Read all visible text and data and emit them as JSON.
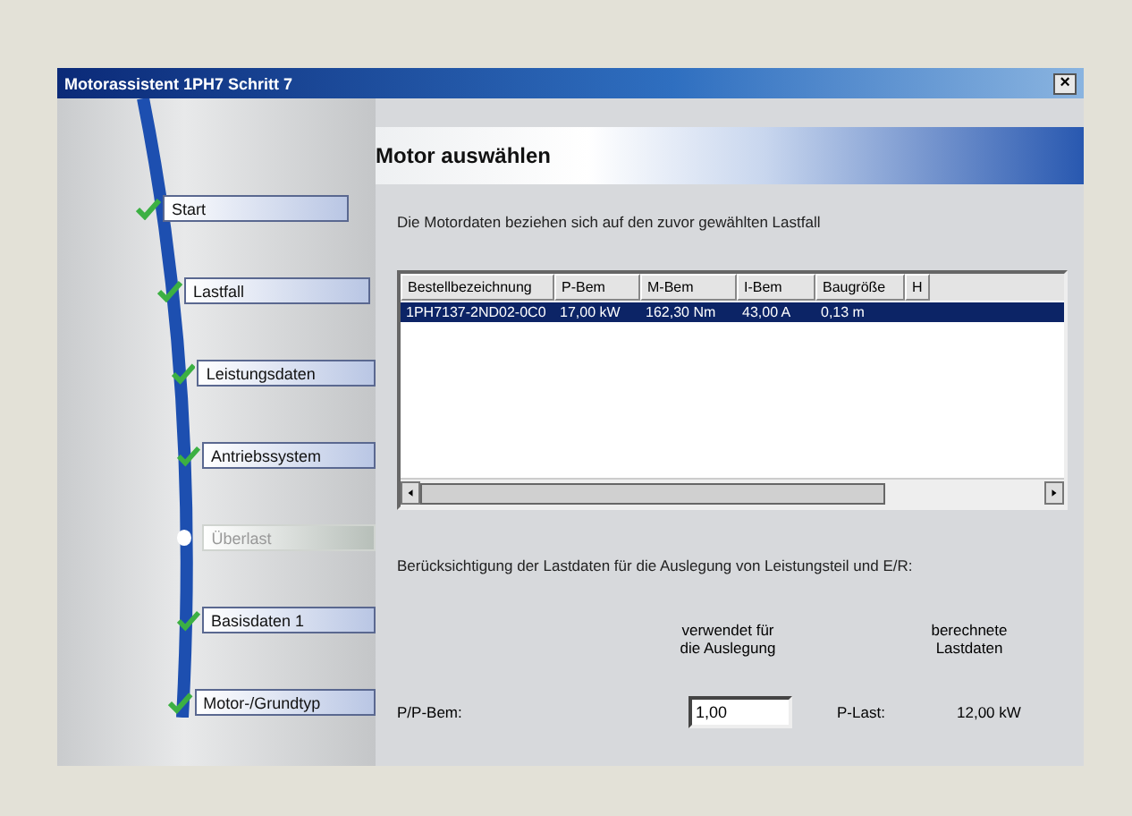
{
  "window": {
    "title": "Motorassistent 1PH7 Schritt 7",
    "close": "×"
  },
  "steps": [
    {
      "label": "Start",
      "done": true
    },
    {
      "label": "Lastfall",
      "done": true
    },
    {
      "label": "Leistungsdaten",
      "done": true
    },
    {
      "label": "Antriebssystem",
      "done": true
    },
    {
      "label": "Überlast",
      "done": false
    },
    {
      "label": "Basisdaten 1",
      "done": true
    },
    {
      "label": "Motor-/Grundtyp",
      "done": true
    }
  ],
  "header": "Motor auswählen",
  "intro": "Die Motordaten beziehen sich auf den zuvor gewählten Lastfall",
  "table": {
    "columns": [
      "Bestellbezeichnung",
      "P-Bem",
      "M-Bem",
      "I-Bem",
      "Baugröße",
      "H"
    ],
    "rows": [
      {
        "cells": [
          "1PH7137-2ND02-0C0",
          "17,00 kW",
          "162,30 Nm",
          "43,00 A",
          "0,13 m"
        ],
        "selected": true
      }
    ]
  },
  "load_note": "Berücksichtigung der Lastdaten für die Auslegung von Leistungsteil und E/R:",
  "col_used": [
    "verwendet für",
    "die Auslegung"
  ],
  "col_calc": [
    "berechnete",
    "Lastdaten"
  ],
  "ratio": {
    "label": "P/P-Bem:",
    "value": "1,00",
    "calc_label": "P-Last:",
    "calc_value": "12,00 kW"
  }
}
